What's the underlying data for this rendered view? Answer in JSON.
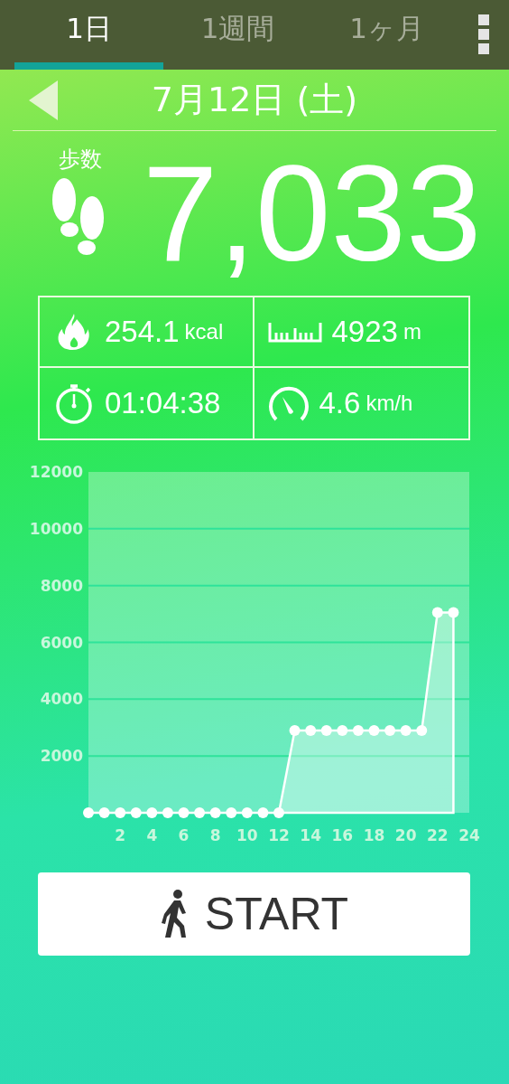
{
  "tabs": [
    {
      "label": "1日",
      "selected": true
    },
    {
      "label": "1週間",
      "selected": false
    },
    {
      "label": "1ヶ月",
      "selected": false
    }
  ],
  "date": "7月12日 (土)",
  "steps": {
    "label": "歩数",
    "value": "7,033"
  },
  "stats": [
    {
      "kind": "calories",
      "value": "254.1",
      "unit": "kcal"
    },
    {
      "kind": "distance",
      "value": "4923",
      "unit": "m"
    },
    {
      "kind": "time",
      "value": "01:04:38"
    },
    {
      "kind": "speed",
      "value": "4.6",
      "unit": "km/h"
    }
  ],
  "chart": {
    "chart_data": {
      "type": "area",
      "x": [
        0,
        1,
        2,
        3,
        4,
        5,
        6,
        7,
        8,
        9,
        10,
        11,
        12,
        13,
        14,
        15,
        16,
        17,
        18,
        19,
        20,
        21,
        22,
        23
      ],
      "series": [
        {
          "color": "#ffffff",
          "values": [
            0,
            0,
            0,
            0,
            0,
            0,
            0,
            0,
            0,
            0,
            0,
            0,
            0,
            2900,
            2900,
            2900,
            2900,
            2900,
            2900,
            2900,
            2900,
            2900,
            7050,
            7050
          ]
        }
      ],
      "xlim": [
        0,
        24
      ],
      "ylim": [
        0,
        12000
      ],
      "xticks": [
        2,
        4,
        6,
        8,
        10,
        12,
        14,
        16,
        18,
        20,
        22,
        24
      ],
      "yticks": [
        2000,
        4000,
        6000,
        8000,
        10000,
        12000
      ],
      "grid": true
    }
  },
  "start_button": {
    "label": "START"
  }
}
